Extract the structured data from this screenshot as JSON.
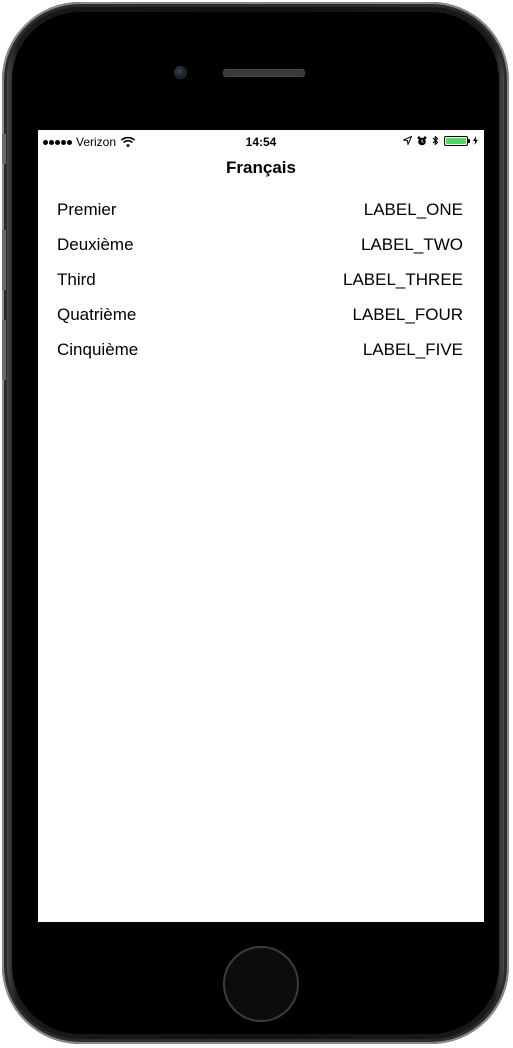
{
  "status_bar": {
    "carrier": "Verizon",
    "time": "14:54",
    "battery_color": "#4cd964"
  },
  "nav": {
    "title": "Français"
  },
  "rows": [
    {
      "label": "Premier",
      "value": "LABEL_ONE"
    },
    {
      "label": "Deuxième",
      "value": "LABEL_TWO"
    },
    {
      "label": "Third",
      "value": "LABEL_THREE"
    },
    {
      "label": "Quatrième",
      "value": "LABEL_FOUR"
    },
    {
      "label": "Cinquième",
      "value": "LABEL_FIVE"
    }
  ],
  "icons": {
    "signal": "signal-dots-icon",
    "wifi": "wifi-icon",
    "location": "location-arrow-icon",
    "alarm": "alarm-clock-icon",
    "bluetooth": "bluetooth-icon",
    "battery": "battery-icon",
    "charging": "charging-bolt-icon"
  }
}
